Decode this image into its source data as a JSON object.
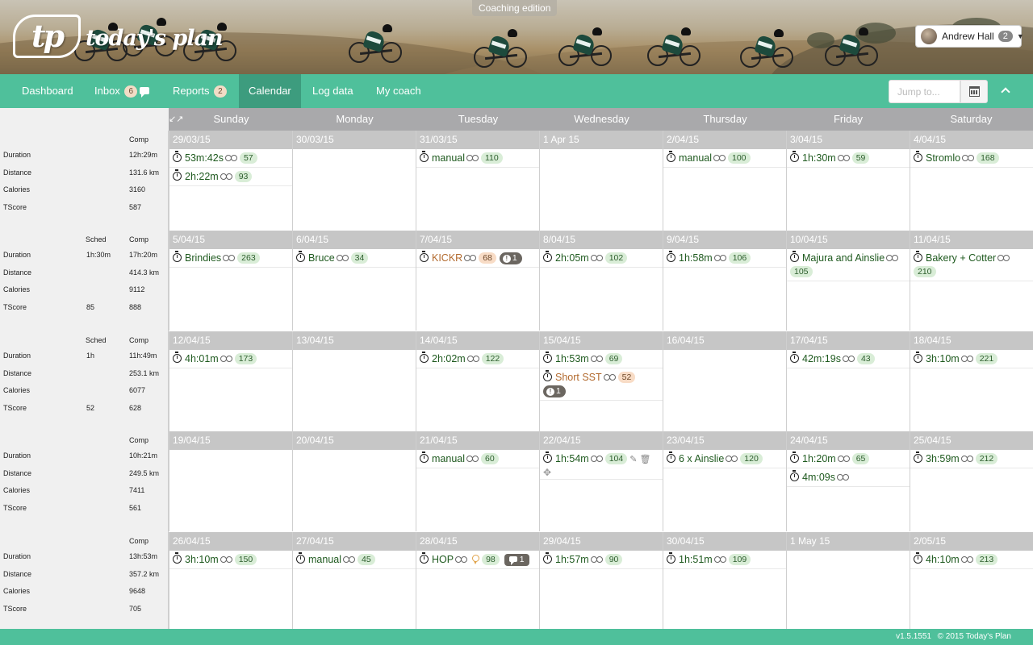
{
  "header": {
    "logo_mark": "tp",
    "logo_text": "today's plan",
    "edition": "Coaching edition",
    "user_name": "Andrew Hall",
    "user_badge": "2"
  },
  "nav": {
    "dashboard": "Dashboard",
    "inbox": "Inbox",
    "inbox_badge": "6",
    "reports": "Reports",
    "reports_badge": "2",
    "calendar": "Calendar",
    "log_data": "Log data",
    "my_coach": "My coach",
    "jump_placeholder": "Jump to..."
  },
  "days": [
    "Sunday",
    "Monday",
    "Tuesday",
    "Wednesday",
    "Thursday",
    "Friday",
    "Saturday"
  ],
  "summary_labels": {
    "sched": "Sched",
    "comp": "Comp",
    "duration": "Duration",
    "distance": "Distance",
    "calories": "Calories",
    "tscore": "TScore"
  },
  "weeks": [
    {
      "summary": {
        "duration_sched": "",
        "duration_comp": "12h:29m",
        "distance_comp": "131.6 km",
        "calories_comp": "3160",
        "tscore_sched": "",
        "tscore_comp": "587"
      },
      "days": [
        {
          "date": "29/03/15",
          "activities": [
            {
              "name": "53m:42s",
              "ts": "57"
            },
            {
              "name": "2h:22m",
              "ts": "93"
            }
          ]
        },
        {
          "date": "30/03/15",
          "activities": []
        },
        {
          "date": "31/03/15",
          "activities": [
            {
              "name": "manual",
              "ts": "110"
            }
          ]
        },
        {
          "date": "1 Apr 15",
          "activities": []
        },
        {
          "date": "2/04/15",
          "activities": [
            {
              "name": "manual",
              "ts": "100"
            }
          ]
        },
        {
          "date": "3/04/15",
          "activities": [
            {
              "name": "1h:30m",
              "ts": "59"
            }
          ]
        },
        {
          "date": "4/04/15",
          "activities": [
            {
              "name": "Stromlo",
              "ts": "168"
            }
          ]
        }
      ]
    },
    {
      "summary": {
        "duration_sched": "1h:30m",
        "duration_comp": "17h:20m",
        "distance_comp": "414.3 km",
        "calories_comp": "9112",
        "tscore_sched": "85",
        "tscore_comp": "888"
      },
      "days": [
        {
          "date": "5/04/15",
          "activities": [
            {
              "name": "Brindies",
              "ts": "263"
            }
          ]
        },
        {
          "date": "6/04/15",
          "activities": [
            {
              "name": "Bruce",
              "ts": "34"
            }
          ]
        },
        {
          "date": "7/04/15",
          "activities": [
            {
              "name": "KICKR",
              "ts": "68",
              "planned": true,
              "alert": "1"
            }
          ]
        },
        {
          "date": "8/04/15",
          "activities": [
            {
              "name": "2h:05m",
              "ts": "102"
            }
          ]
        },
        {
          "date": "9/04/15",
          "activities": [
            {
              "name": "1h:58m",
              "ts": "106"
            }
          ]
        },
        {
          "date": "10/04/15",
          "activities": [
            {
              "name": "Majura and Ainslie",
              "ts": "105",
              "wrap": true
            }
          ]
        },
        {
          "date": "11/04/15",
          "activities": [
            {
              "name": "Bakery + Cotter",
              "ts": "210",
              "wrap": true
            }
          ]
        }
      ]
    },
    {
      "summary": {
        "duration_sched": "1h",
        "duration_comp": "11h:49m",
        "distance_comp": "253.1 km",
        "calories_comp": "6077",
        "tscore_sched": "52",
        "tscore_comp": "628"
      },
      "days": [
        {
          "date": "12/04/15",
          "activities": [
            {
              "name": "4h:01m",
              "ts": "173"
            }
          ]
        },
        {
          "date": "13/04/15",
          "activities": []
        },
        {
          "date": "14/04/15",
          "activities": [
            {
              "name": "2h:02m",
              "ts": "122"
            }
          ]
        },
        {
          "date": "15/04/15",
          "activities": [
            {
              "name": "1h:53m",
              "ts": "69"
            },
            {
              "name": "Short SST",
              "ts": "52",
              "planned": true,
              "alert_below": "1"
            }
          ]
        },
        {
          "date": "16/04/15",
          "activities": []
        },
        {
          "date": "17/04/15",
          "activities": [
            {
              "name": "42m:19s",
              "ts": "43"
            }
          ]
        },
        {
          "date": "18/04/15",
          "activities": [
            {
              "name": "3h:10m",
              "ts": "221"
            }
          ]
        }
      ]
    },
    {
      "summary": {
        "duration_sched": "",
        "duration_comp": "10h:21m",
        "distance_comp": "249.5 km",
        "calories_comp": "7411",
        "tscore_sched": "",
        "tscore_comp": "561"
      },
      "days": [
        {
          "date": "19/04/15",
          "activities": []
        },
        {
          "date": "20/04/15",
          "activities": []
        },
        {
          "date": "21/04/15",
          "activities": [
            {
              "name": "manual",
              "ts": "60"
            }
          ]
        },
        {
          "date": "22/04/15",
          "activities": [
            {
              "name": "1h:54m",
              "ts": "104",
              "tools": true
            }
          ]
        },
        {
          "date": "23/04/15",
          "activities": [
            {
              "name": "6 x Ainslie",
              "ts": "120"
            }
          ]
        },
        {
          "date": "24/04/15",
          "activities": [
            {
              "name": "1h:20m",
              "ts": "65"
            },
            {
              "name": "4m:09s"
            }
          ]
        },
        {
          "date": "25/04/15",
          "activities": [
            {
              "name": "3h:59m",
              "ts": "212"
            }
          ]
        }
      ]
    },
    {
      "summary": {
        "duration_sched": "",
        "duration_comp": "13h:53m",
        "distance_comp": "357.2 km",
        "calories_comp": "9648",
        "tscore_sched": "",
        "tscore_comp": "705"
      },
      "days": [
        {
          "date": "26/04/15",
          "activities": [
            {
              "name": "3h:10m",
              "ts": "150"
            }
          ]
        },
        {
          "date": "27/04/15",
          "activities": [
            {
              "name": "manual",
              "ts": "45"
            }
          ]
        },
        {
          "date": "28/04/15",
          "activities": [
            {
              "name": "HOP",
              "ts": "98",
              "medal": true,
              "comment": "1"
            }
          ]
        },
        {
          "date": "29/04/15",
          "activities": [
            {
              "name": "1h:57m",
              "ts": "90"
            }
          ]
        },
        {
          "date": "30/04/15",
          "activities": [
            {
              "name": "1h:51m",
              "ts": "109"
            }
          ]
        },
        {
          "date": "1 May 15",
          "activities": []
        },
        {
          "date": "2/05/15",
          "activities": [
            {
              "name": "4h:10m",
              "ts": "213"
            }
          ]
        }
      ]
    }
  ],
  "week_has_sched": [
    false,
    true,
    true,
    false,
    false
  ],
  "footer": {
    "version": "v1.5.1551",
    "copyright": "© 2015 Today's Plan"
  },
  "colors": {
    "brand": "#4fc09b",
    "nav_active": "#3d9c7e",
    "planned": "#b26a2e",
    "completed": "#1f5a1f"
  },
  "icons": [
    "stopwatch-icon",
    "bike-icon",
    "alert-icon",
    "comment-icon",
    "medal-icon",
    "edit-icon",
    "trash-icon",
    "move-icon",
    "calendar-icon",
    "chevron-up-icon",
    "compress-icon",
    "chat-icon"
  ]
}
